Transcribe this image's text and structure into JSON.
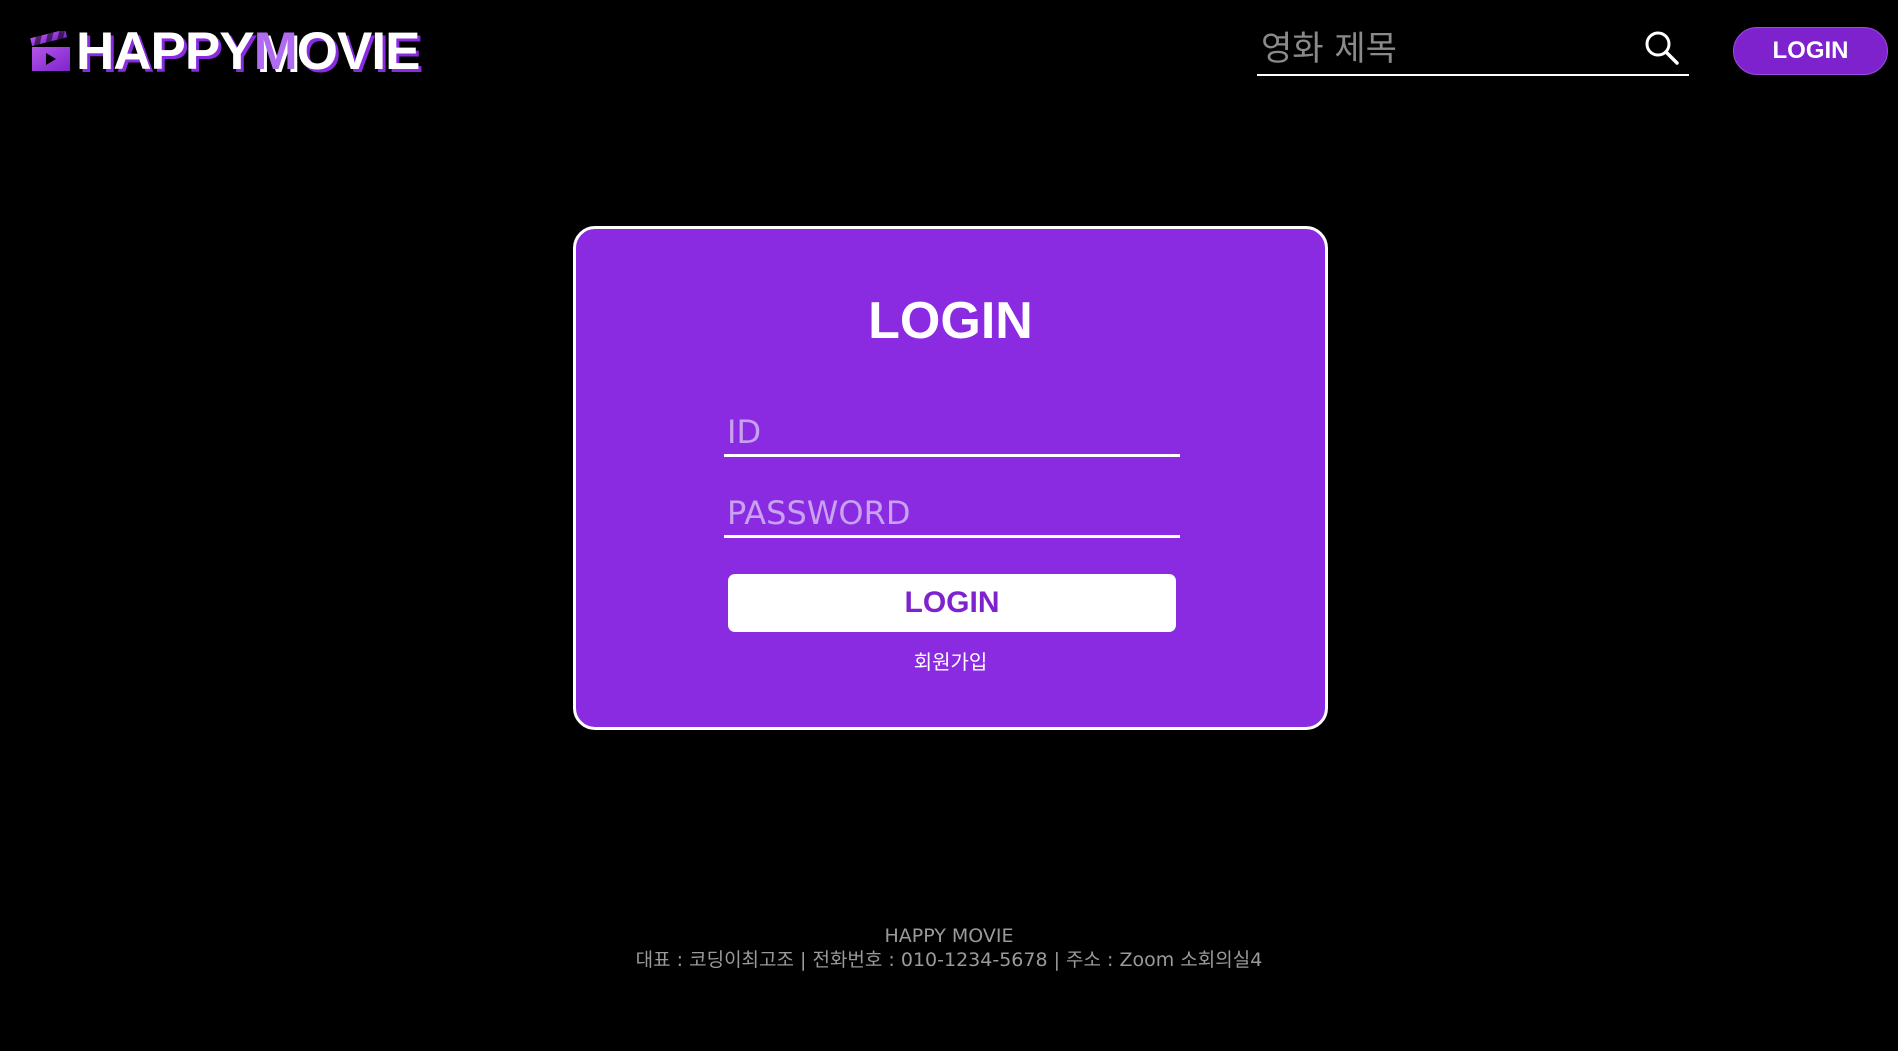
{
  "header": {
    "logo": {
      "part1": "HAPPY",
      "part2": "M",
      "part3": "OVIE",
      "icon": "clapperboard-icon"
    },
    "search": {
      "placeholder": "영화 제목",
      "value": "",
      "icon": "search-icon"
    },
    "login_label": "LOGIN"
  },
  "login_card": {
    "title": "LOGIN",
    "id_placeholder": "ID",
    "password_placeholder": "PASSWORD",
    "submit_label": "LOGIN",
    "signup_label": "회원가입"
  },
  "footer": {
    "company": "HAPPY MOVIE",
    "info": "대표 : 코딩이최고조 | 전화번호 : 010-1234-5678 | 주소 : Zoom 소회의실4"
  },
  "colors": {
    "background": "#000000",
    "accent": "#8a2be2",
    "button_purple": "#7e22ce",
    "white": "#ffffff"
  }
}
